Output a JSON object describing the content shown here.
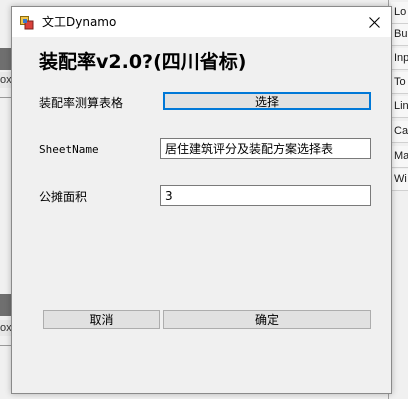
{
  "window": {
    "title": "文工Dynamo",
    "close_glyph": "✕"
  },
  "heading": "装配率v2.0?(四川省标)",
  "form": {
    "table_label": "装配率测算表格",
    "select_button": "选择",
    "sheet_label": "SheetName",
    "sheet_value": "居住建筑评分及装配方案选择表",
    "area_label": "公摊面积",
    "area_value": "3"
  },
  "buttons": {
    "cancel": "取消",
    "ok": "确定"
  },
  "background": {
    "right_tabs": [
      "Lo",
      "Bu",
      "Inp",
      "To",
      "Lin",
      "Ca",
      "Ma",
      "Wi"
    ],
    "left_snippets": [
      "ox",
      "ox"
    ]
  },
  "colors": {
    "focus_border": "#0078d7",
    "button_face": "#e1e1e1",
    "window_bg": "#f0f0f0"
  }
}
